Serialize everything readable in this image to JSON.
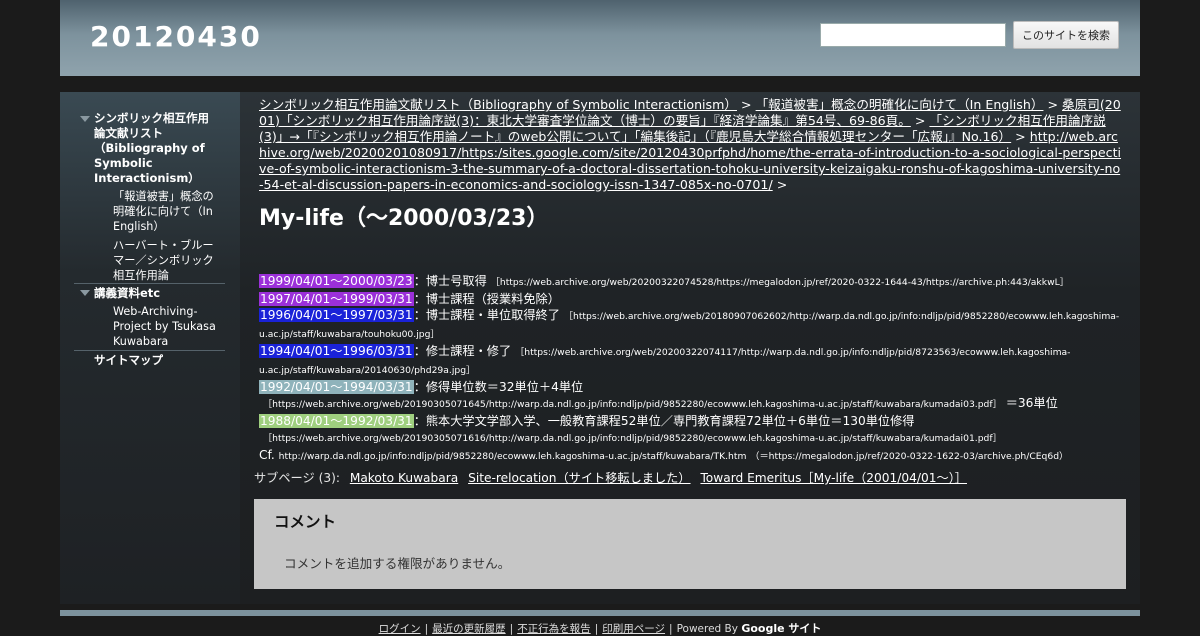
{
  "site": {
    "title": "20120430"
  },
  "search": {
    "placeholder": "",
    "button_label": "このサイトを検索"
  },
  "sidebar": {
    "items": [
      {
        "label": "シンボリック相互作用論文献リスト（Bibliography of Symbolic Interactionism）"
      },
      {
        "label": "「報道被害」概念の明確化に向けて（In English）"
      },
      {
        "label": "ハーバート・ブルーマー／シンボリック相互作用論"
      },
      {
        "label": "講義資料etc"
      },
      {
        "label": "Web-Archiving-Project by Tsukasa Kuwabara"
      },
      {
        "label": "サイトマップ"
      }
    ]
  },
  "breadcrumb": {
    "items": [
      "シンボリック相互作用論文献リスト（Bibliography of Symbolic Interactionism）",
      "「報道被害」概念の明確化に向けて（In English）",
      "桑原司(2001)「シンボリック相互作用論序説(3)：東北大学審査学位論文（博士）の要旨」『経済学論集』第54号、69-86頁。",
      "「シンボリック相互作用論序説(3)」→「『シンボリック相互作用論ノート』のweb公開について」「編集後記」（『鹿児島大学総合情報処理センター「広報」』No.16）",
      "http://web.archive.org/web/20200201080917/https:/sites.google.com/site/20120430prfphd/home/the-errata-of-introduction-to-a-sociological-perspective-of-symbolic-interactionism-3-the-summary-of-a-doctoral-dissertation-tohoku-university-keizaigaku-ronshu-of-kagoshima-university-no-54-et-al-discussion-papers-in-economics-and-sociology-issn-1347-085x-no-0701/"
    ],
    "separator": ">"
  },
  "page": {
    "title": "My-life（～2000/03/23）"
  },
  "timeline": [
    {
      "date": "1999/04/01～2000/03/23",
      "color": "#9b30d9",
      "text": "：博士号取得",
      "ref": "［https://web.archive.org/web/20200322074528/https://megalodon.jp/ref/2020-0322-1644-43/https://archive.ph:443/akkwL］"
    },
    {
      "date": "1997/04/01～1999/03/31",
      "color": "#9b30d9",
      "text": "：博士課程（授業料免除）",
      "ref": ""
    },
    {
      "date": "1996/04/01～1997/03/31",
      "color": "#1a22d8",
      "text": "：博士課程・単位取得終了",
      "ref": "［https://web.archive.org/web/20180907062602/http://warp.da.ndl.go.jp/info:ndljp/pid/9852280/ecowww.leh.kagoshima-u.ac.jp/staff/kuwabara/touhoku00.jpg］"
    },
    {
      "date": "1994/04/01～1996/03/31",
      "color": "#1a22d8",
      "text": "：修士課程・修了",
      "ref": "［https://web.archive.org/web/20200322074117/http://warp.da.ndl.go.jp/info:ndljp/pid/8723563/ecowww.leh.kagoshima-u.ac.jp/staff/kuwabara/20140630/phd29a.jpg］"
    },
    {
      "date": "1992/04/01～1994/03/31",
      "color": "#8fb3bb",
      "text": "：修得単位数＝32単位＋4単位",
      "ref": "［https://web.archive.org/web/20190305071645/http://warp.da.ndl.go.jp/info:ndljp/pid/9852280/ecowww.leh.kagoshima-u.ac.jp/staff/kuwabara/kumadai03.pdf］",
      "suffix": "＝36単位"
    },
    {
      "date": "1988/04/01～1992/03/31",
      "color": "#9fcf7f",
      "text": "：熊本大学文学部入学、一般教育課程52単位／専門教育課程72単位＋6単位＝130単位修得",
      "ref": "［https://web.archive.org/web/20190305071616/http://warp.da.ndl.go.jp/info:ndljp/pid/9852280/ecowww.leh.kagoshima-u.ac.jp/staff/kuwabara/kumadai01.pdf］"
    }
  ],
  "cf": {
    "label": "Cf.",
    "url": "http://warp.da.ndl.go.jp/info:ndljp/pid/9852280/ecowww.leh.kagoshima-u.ac.jp/staff/kuwabara/TK.htm",
    "alt": "（＝https://megalodon.jp/ref/2020-0322-1622-03/archive.ph/CEq6d）"
  },
  "subpages": {
    "label": "サブページ (3):",
    "items": [
      "Makoto Kuwabara",
      "Site-relocation（サイト移転しました）",
      "Toward Emeritus［My-life（2001/04/01～）］"
    ]
  },
  "comments": {
    "title": "コメント",
    "message": "コメントを追加する権限がありません。"
  },
  "footer": {
    "links": [
      "ログイン",
      "最近の更新履歴",
      "不正行為を報告",
      "印刷用ページ"
    ],
    "powered_by": "Powered By",
    "brand": "Google サイト"
  }
}
